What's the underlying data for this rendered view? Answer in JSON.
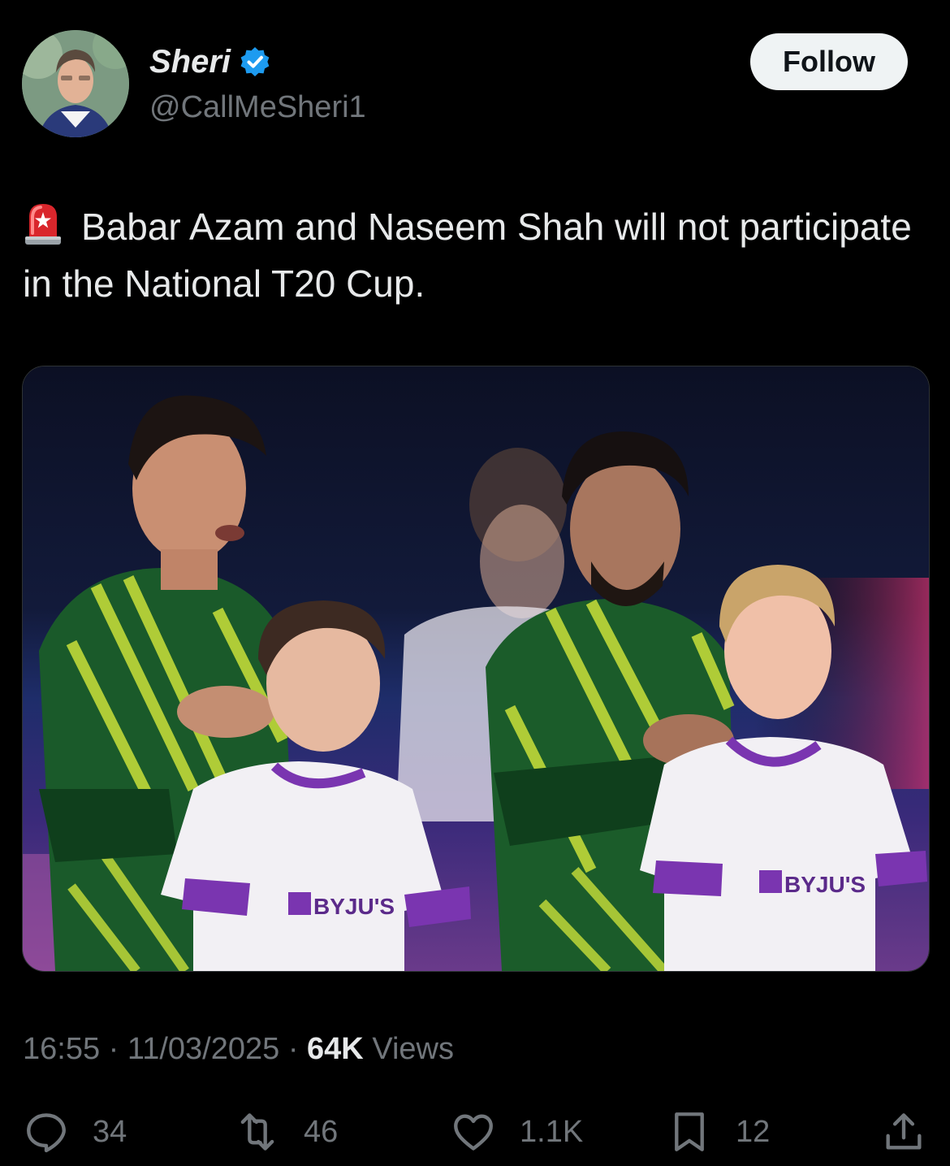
{
  "author": {
    "display_name": "Sheri",
    "handle": "@CallMeSheri1",
    "verified": true,
    "verified_color": "#1d9bf0",
    "avatar_icon": "profile-photo"
  },
  "follow_button": {
    "label": "Follow"
  },
  "tweet": {
    "emoji_icon": "police-siren-icon",
    "text": "Babar Azam and Naseem Shah will not participate in the National T20 Cup."
  },
  "media": {
    "kind": "photo",
    "jersey_texts": [
      "BYJU'S",
      "BYJU'S"
    ]
  },
  "meta": {
    "time": "16:55",
    "separator": "·",
    "date": "11/03/2025",
    "views_count": "64K",
    "views_label": "Views"
  },
  "actions": {
    "replies": "34",
    "reposts": "46",
    "likes": "1.1K",
    "bookmarks": "12"
  },
  "colors": {
    "background": "#000000",
    "text_primary": "#e7e9ea",
    "text_secondary": "#71767b",
    "follow_bg": "#eff3f4"
  }
}
